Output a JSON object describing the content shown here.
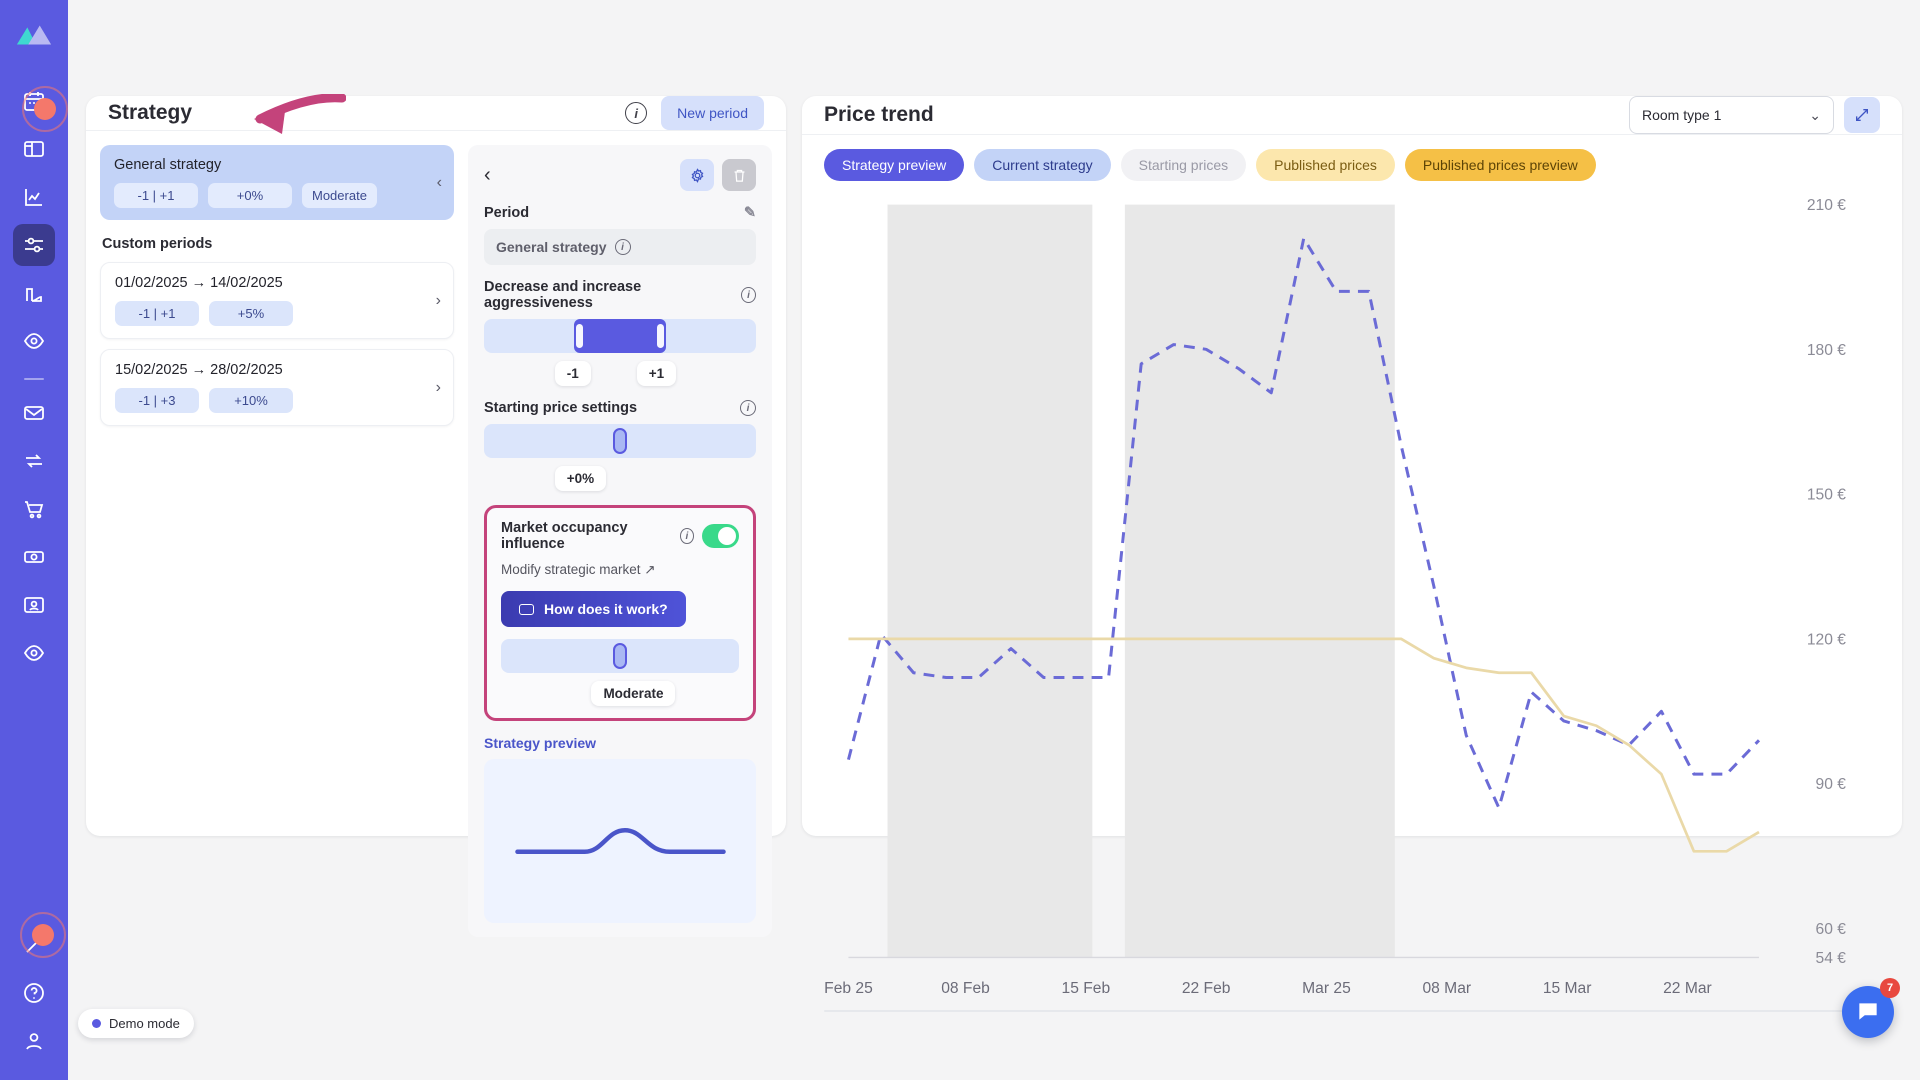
{
  "sidebar": {
    "logo": "mountain-logo",
    "items": [
      {
        "name": "calendar",
        "label": "Calendar"
      },
      {
        "name": "layout",
        "label": "Dashboard"
      },
      {
        "name": "chart",
        "label": "Analytics"
      },
      {
        "name": "sliders",
        "label": "Strategy",
        "active": true
      },
      {
        "name": "podium",
        "label": "Benchmark"
      },
      {
        "name": "eye",
        "label": "Market"
      },
      {
        "name": "mail",
        "label": "Inbox"
      },
      {
        "name": "exchange",
        "label": "Sync"
      },
      {
        "name": "cart",
        "label": "Orders"
      },
      {
        "name": "money",
        "label": "Revenue"
      },
      {
        "name": "id-card",
        "label": "Guests"
      },
      {
        "name": "eye2",
        "label": "Insights"
      }
    ],
    "bottom": [
      {
        "name": "magic-wand",
        "label": "Assistant"
      },
      {
        "name": "help",
        "label": "Help"
      },
      {
        "name": "user",
        "label": "Account"
      }
    ]
  },
  "demo": {
    "label": "Demo mode"
  },
  "strategy": {
    "title": "Strategy",
    "new_period_label": "New period",
    "general": {
      "title": "General strategy",
      "chips": [
        "-1 | +1",
        "+0%",
        "Moderate"
      ]
    },
    "custom_periods_label": "Custom periods",
    "periods": [
      {
        "range": "01/02/2025 → 14/02/2025",
        "chips": [
          "-1 | +1",
          "+5%"
        ]
      },
      {
        "range": "15/02/2025 → 28/02/2025",
        "chips": [
          "-1 | +3",
          "+10%"
        ]
      }
    ],
    "detail": {
      "period_label": "Period",
      "period_value": "General strategy",
      "aggressiveness_label": "Decrease and increase aggressiveness",
      "aggressiveness_min": "-1",
      "aggressiveness_max": "+1",
      "starting_price_label": "Starting price settings",
      "starting_price_value": "+0%",
      "market_occupancy_label": "Market occupancy influence",
      "market_occupancy_toggle": "on",
      "modify_market_label": "Modify strategic market ↗",
      "how_it_works_label": "How does it work?",
      "occupancy_value": "Moderate",
      "strategy_preview_label": "Strategy preview"
    }
  },
  "price_trend": {
    "title": "Price trend",
    "room_type": "Room type 1",
    "tabs": [
      {
        "label": "Strategy preview",
        "style": "blue-solid",
        "active": true
      },
      {
        "label": "Current strategy",
        "style": "blue-light",
        "active": false
      },
      {
        "label": "Starting prices",
        "style": "grey",
        "active": false
      },
      {
        "label": "Published prices",
        "style": "yellow-light",
        "active": false
      },
      {
        "label": "Published prices preview",
        "style": "yellow-solid",
        "active": false
      }
    ]
  },
  "chat": {
    "badge": "7"
  },
  "chart_data": {
    "type": "line",
    "title": "Price trend",
    "xlabel": "",
    "ylabel": "",
    "ylim": [
      54,
      210
    ],
    "y_ticks": [
      54,
      60,
      90,
      120,
      150,
      180,
      210
    ],
    "y_tick_labels": [
      "54 €",
      "60 €",
      "90 €",
      "120 €",
      "150 €",
      "180 €",
      "210 €"
    ],
    "x_tick_labels": [
      "Feb 25",
      "08 Feb",
      "15 Feb",
      "22 Feb",
      "Mar 25",
      "08 Mar",
      "15 Mar",
      "22 Mar"
    ],
    "grid": false,
    "legend_position": "top",
    "shaded_bands": [
      {
        "from_label": "Feb 25",
        "to_label": "15 Feb"
      },
      {
        "from_label": "15 Feb",
        "to_label": "Mar 25"
      }
    ],
    "series": [
      {
        "name": "Strategy preview",
        "color": "#6b6bd6",
        "style": "dashed",
        "x": [
          "Feb 25",
          "Feb 27",
          "01 Mar",
          "04 Feb",
          "06 Feb",
          "08 Feb",
          "10 Feb",
          "12 Feb",
          "14 Feb",
          "15 Feb",
          "17 Feb",
          "19 Feb",
          "21 Feb",
          "22 Feb",
          "24 Feb",
          "26 Feb",
          "28 Feb",
          "Mar 25",
          "03 Mar",
          "05 Mar",
          "07 Mar",
          "08 Mar",
          "10 Mar",
          "12 Mar",
          "15 Mar",
          "17 Mar",
          "19 Mar",
          "21 Mar",
          "22 Mar"
        ],
        "values": [
          95,
          121,
          113,
          112,
          112,
          118,
          112,
          112,
          112,
          177,
          181,
          180,
          176,
          171,
          203,
          192,
          192,
          160,
          131,
          100,
          85,
          109,
          103,
          101,
          98,
          105,
          92,
          92,
          99
        ]
      },
      {
        "name": "Published prices preview",
        "color": "#ead9a8",
        "style": "solid",
        "x": [
          "Feb 25",
          "Feb 27",
          "01 Mar",
          "04 Feb",
          "06 Feb",
          "08 Feb",
          "10 Feb",
          "12 Feb",
          "14 Feb",
          "15 Feb",
          "17 Feb",
          "19 Feb",
          "21 Feb",
          "22 Feb",
          "24 Feb",
          "26 Feb",
          "28 Feb",
          "Mar 25",
          "03 Mar",
          "05 Mar",
          "07 Mar",
          "08 Mar",
          "10 Mar",
          "12 Mar",
          "15 Mar",
          "17 Mar",
          "19 Mar",
          "21 Mar",
          "22 Mar"
        ],
        "values": [
          120,
          120,
          120,
          120,
          120,
          120,
          120,
          120,
          120,
          120,
          120,
          120,
          120,
          120,
          120,
          120,
          120,
          120,
          116,
          114,
          113,
          113,
          104,
          102,
          98,
          92,
          76,
          76,
          80
        ]
      }
    ]
  }
}
